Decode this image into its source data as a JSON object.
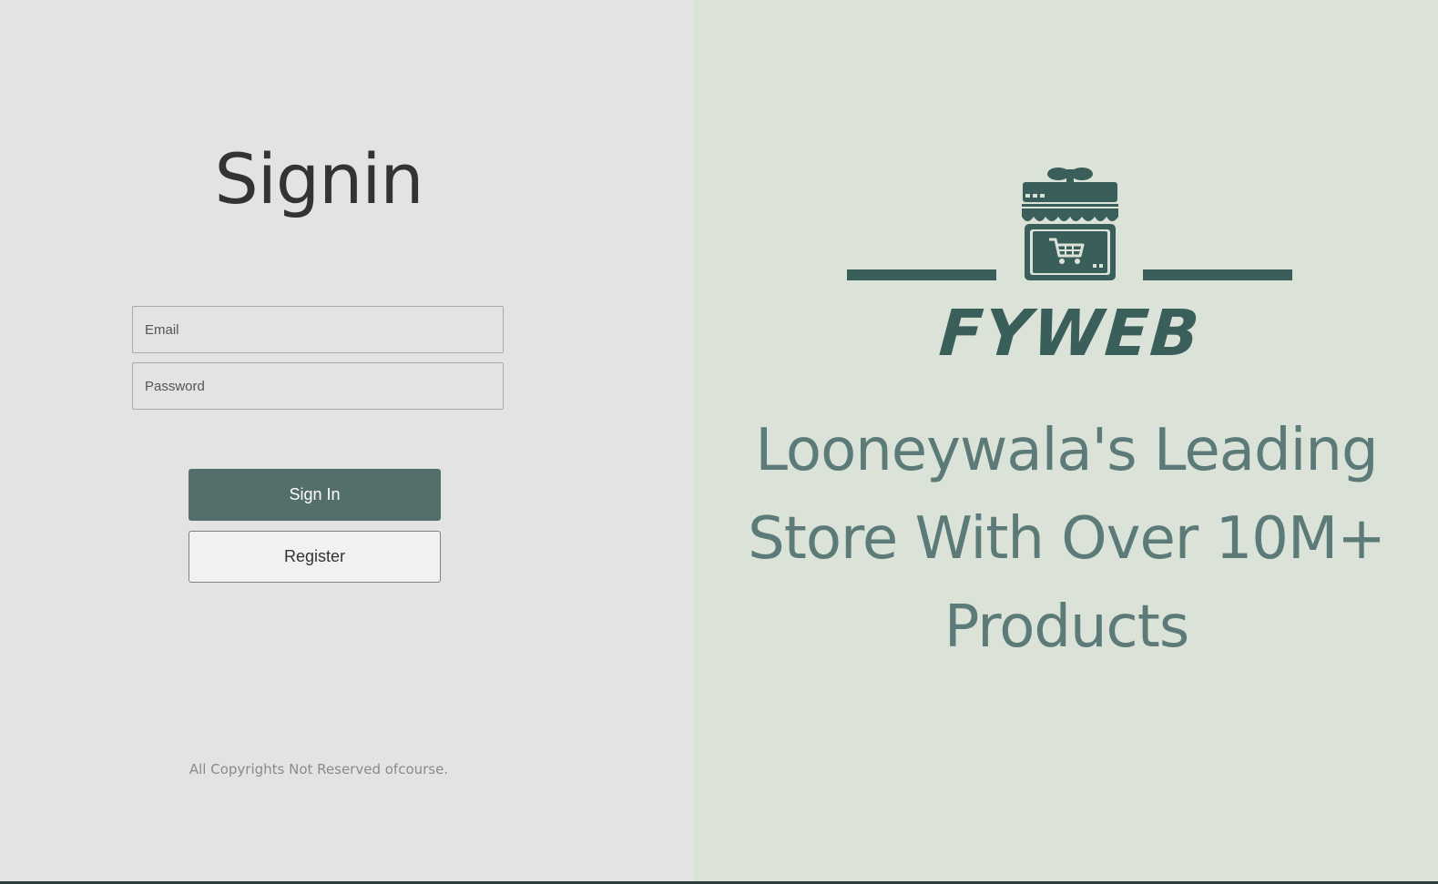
{
  "signin": {
    "title": "Signin",
    "email_placeholder": "Email",
    "password_placeholder": "Password",
    "signin_button": "Sign In",
    "register_button": "Register",
    "copyright": "All Copyrights Not Reserved ofcourse."
  },
  "brand": {
    "name": "FYWEB",
    "logo_icon": "storefront-cart-icon",
    "tagline": "Looneywala's Leading Store With Over 10M+ Products"
  },
  "colors": {
    "accent": "#546e6b",
    "brand": "#3a5e5a",
    "left_bg": "#e3e3e3",
    "right_bg": "#dbe3d8",
    "tagline": "#5c7a77"
  }
}
